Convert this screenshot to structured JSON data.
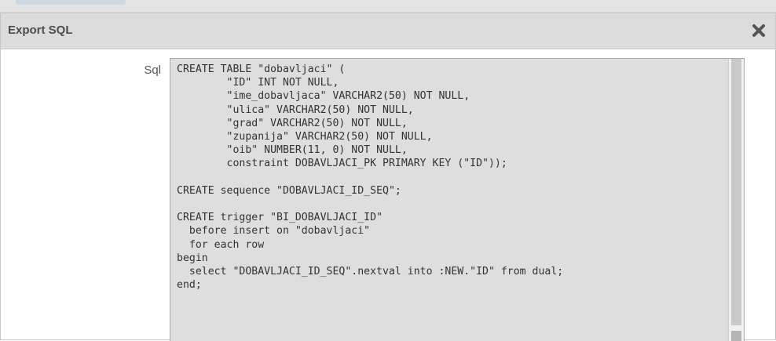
{
  "dialog": {
    "title": "Export SQL",
    "close_icon": "close-icon"
  },
  "form": {
    "sql_label": "Sql",
    "sql_value": "CREATE TABLE \"dobavljaci\" (\n        \"ID\" INT NOT NULL,\n        \"ime_dobavljaca\" VARCHAR2(50) NOT NULL,\n        \"ulica\" VARCHAR2(50) NOT NULL,\n        \"grad\" VARCHAR2(50) NOT NULL,\n        \"zupanija\" VARCHAR2(50) NOT NULL,\n        \"oib\" NUMBER(11, 0) NOT NULL,\n        constraint DOBAVLJACI_PK PRIMARY KEY (\"ID\"));\n\nCREATE sequence \"DOBAVLJACI_ID_SEQ\";\n\nCREATE trigger \"BI_DOBAVLJACI_ID\"\n  before insert on \"dobavljaci\"\n  for each row\nbegin\n  select \"DOBAVLJACI_ID_SEQ\".nextval into :NEW.\"ID\" from dual;\nend;"
  },
  "colors": {
    "titlebar_bg": "#dcdcdc",
    "code_bg": "#dedede",
    "title_text": "#4c4c4c"
  }
}
